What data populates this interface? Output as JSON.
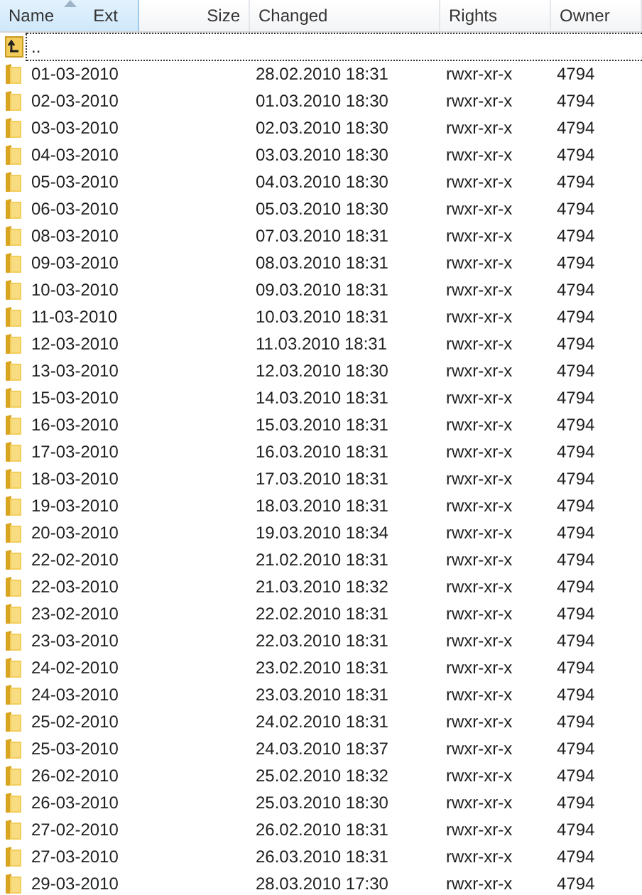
{
  "columns": [
    {
      "label": "Name",
      "selected": true,
      "sublabel": "Ext"
    },
    {
      "label": "Size",
      "selected": false
    },
    {
      "label": "Changed",
      "selected": false
    },
    {
      "label": "Rights",
      "selected": false
    },
    {
      "label": "Owner",
      "selected": false
    }
  ],
  "rows": [
    {
      "kind": "up",
      "name": "..",
      "focused": true
    },
    {
      "kind": "folder",
      "name": "01-03-2010",
      "changed": "28.02.2010 18:31",
      "rights": "rwxr-xr-x",
      "owner": "4794",
      "focused": false
    },
    {
      "kind": "folder",
      "name": "02-03-2010",
      "changed": "01.03.2010 18:30",
      "rights": "rwxr-xr-x",
      "owner": "4794",
      "focused": false
    },
    {
      "kind": "folder",
      "name": "03-03-2010",
      "changed": "02.03.2010 18:30",
      "rights": "rwxr-xr-x",
      "owner": "4794",
      "focused": false
    },
    {
      "kind": "folder",
      "name": "04-03-2010",
      "changed": "03.03.2010 18:30",
      "rights": "rwxr-xr-x",
      "owner": "4794",
      "focused": false
    },
    {
      "kind": "folder",
      "name": "05-03-2010",
      "changed": "04.03.2010 18:30",
      "rights": "rwxr-xr-x",
      "owner": "4794",
      "focused": false
    },
    {
      "kind": "folder",
      "name": "06-03-2010",
      "changed": "05.03.2010 18:30",
      "rights": "rwxr-xr-x",
      "owner": "4794",
      "focused": false
    },
    {
      "kind": "folder",
      "name": "08-03-2010",
      "changed": "07.03.2010 18:31",
      "rights": "rwxr-xr-x",
      "owner": "4794",
      "focused": false
    },
    {
      "kind": "folder",
      "name": "09-03-2010",
      "changed": "08.03.2010 18:31",
      "rights": "rwxr-xr-x",
      "owner": "4794",
      "focused": false
    },
    {
      "kind": "folder",
      "name": "10-03-2010",
      "changed": "09.03.2010 18:31",
      "rights": "rwxr-xr-x",
      "owner": "4794",
      "focused": false
    },
    {
      "kind": "folder",
      "name": "11-03-2010",
      "changed": "10.03.2010 18:31",
      "rights": "rwxr-xr-x",
      "owner": "4794",
      "focused": false
    },
    {
      "kind": "folder",
      "name": "12-03-2010",
      "changed": "11.03.2010 18:31",
      "rights": "rwxr-xr-x",
      "owner": "4794",
      "focused": false
    },
    {
      "kind": "folder",
      "name": "13-03-2010",
      "changed": "12.03.2010 18:30",
      "rights": "rwxr-xr-x",
      "owner": "4794",
      "focused": false
    },
    {
      "kind": "folder",
      "name": "15-03-2010",
      "changed": "14.03.2010 18:31",
      "rights": "rwxr-xr-x",
      "owner": "4794",
      "focused": false
    },
    {
      "kind": "folder",
      "name": "16-03-2010",
      "changed": "15.03.2010 18:31",
      "rights": "rwxr-xr-x",
      "owner": "4794",
      "focused": false
    },
    {
      "kind": "folder",
      "name": "17-03-2010",
      "changed": "16.03.2010 18:31",
      "rights": "rwxr-xr-x",
      "owner": "4794",
      "focused": false
    },
    {
      "kind": "folder",
      "name": "18-03-2010",
      "changed": "17.03.2010 18:31",
      "rights": "rwxr-xr-x",
      "owner": "4794",
      "focused": false
    },
    {
      "kind": "folder",
      "name": "19-03-2010",
      "changed": "18.03.2010 18:31",
      "rights": "rwxr-xr-x",
      "owner": "4794",
      "focused": false
    },
    {
      "kind": "folder",
      "name": "20-03-2010",
      "changed": "19.03.2010 18:34",
      "rights": "rwxr-xr-x",
      "owner": "4794",
      "focused": false
    },
    {
      "kind": "folder",
      "name": "22-02-2010",
      "changed": "21.02.2010 18:31",
      "rights": "rwxr-xr-x",
      "owner": "4794",
      "focused": false
    },
    {
      "kind": "folder",
      "name": "22-03-2010",
      "changed": "21.03.2010 18:32",
      "rights": "rwxr-xr-x",
      "owner": "4794",
      "focused": false
    },
    {
      "kind": "folder",
      "name": "23-02-2010",
      "changed": "22.02.2010 18:31",
      "rights": "rwxr-xr-x",
      "owner": "4794",
      "focused": false
    },
    {
      "kind": "folder",
      "name": "23-03-2010",
      "changed": "22.03.2010 18:31",
      "rights": "rwxr-xr-x",
      "owner": "4794",
      "focused": false
    },
    {
      "kind": "folder",
      "name": "24-02-2010",
      "changed": "23.02.2010 18:31",
      "rights": "rwxr-xr-x",
      "owner": "4794",
      "focused": false
    },
    {
      "kind": "folder",
      "name": "24-03-2010",
      "changed": "23.03.2010 18:31",
      "rights": "rwxr-xr-x",
      "owner": "4794",
      "focused": false
    },
    {
      "kind": "folder",
      "name": "25-02-2010",
      "changed": "24.02.2010 18:31",
      "rights": "rwxr-xr-x",
      "owner": "4794",
      "focused": false
    },
    {
      "kind": "folder",
      "name": "25-03-2010",
      "changed": "24.03.2010 18:37",
      "rights": "rwxr-xr-x",
      "owner": "4794",
      "focused": false
    },
    {
      "kind": "folder",
      "name": "26-02-2010",
      "changed": "25.02.2010 18:32",
      "rights": "rwxr-xr-x",
      "owner": "4794",
      "focused": false
    },
    {
      "kind": "folder",
      "name": "26-03-2010",
      "changed": "25.03.2010 18:30",
      "rights": "rwxr-xr-x",
      "owner": "4794",
      "focused": false
    },
    {
      "kind": "folder",
      "name": "27-02-2010",
      "changed": "26.02.2010 18:31",
      "rights": "rwxr-xr-x",
      "owner": "4794",
      "focused": false
    },
    {
      "kind": "folder",
      "name": "27-03-2010",
      "changed": "26.03.2010 18:31",
      "rights": "rwxr-xr-x",
      "owner": "4794",
      "focused": false
    },
    {
      "kind": "folder",
      "name": "29-03-2010",
      "changed": "28.03.2010 17:30",
      "rights": "rwxr-xr-x",
      "owner": "4794",
      "focused": false
    }
  ]
}
